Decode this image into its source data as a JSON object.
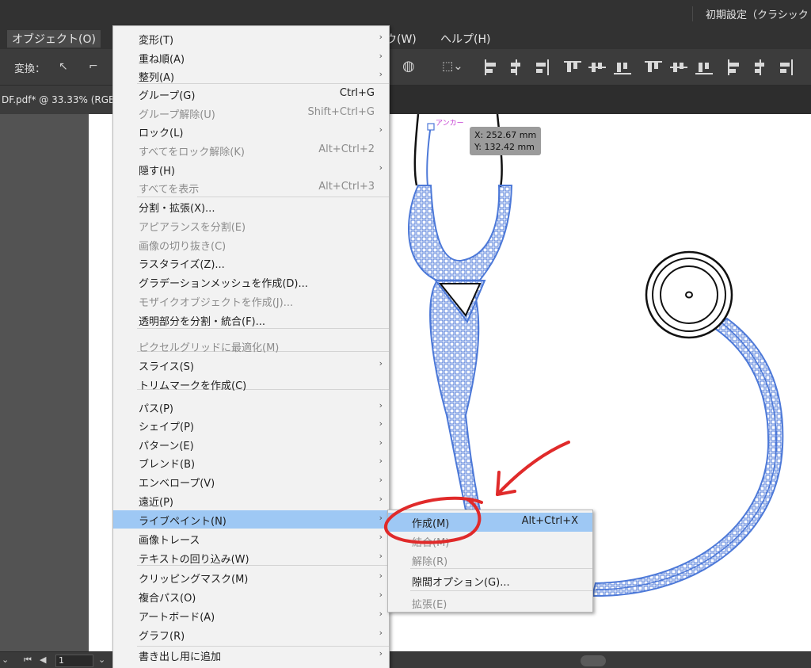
{
  "workspace": {
    "label": "初期設定（クラシック"
  },
  "menubar": {
    "object": "オブジェクト(O)",
    "window": "ウ(W)",
    "help": "ヘルプ(H)"
  },
  "controlbar": {
    "transform_label": "変換："
  },
  "document": {
    "tab_label": "DF.pdf* @ 33.33% (RGB"
  },
  "status": {
    "page": "1"
  },
  "tooltip": {
    "x": "X: 252.67 mm",
    "y": "Y: 132.42 mm"
  },
  "anchor_label": "アンカー",
  "object_menu": {
    "items": [
      {
        "label": "変形(T)",
        "submenu": true
      },
      {
        "label": "重ね順(A)",
        "submenu": true
      },
      {
        "label": "整列(A)",
        "submenu": true
      },
      {
        "label": "グループ(G)",
        "shortcut": "Ctrl+G"
      },
      {
        "label": "グループ解除(U)",
        "shortcut": "Shift+Ctrl+G",
        "disabled": true
      },
      {
        "label": "ロック(L)",
        "submenu": true
      },
      {
        "label": "すべてをロック解除(K)",
        "shortcut": "Alt+Ctrl+2",
        "disabled": true
      },
      {
        "label": "隠す(H)",
        "submenu": true
      },
      {
        "label": "すべてを表示",
        "shortcut": "Alt+Ctrl+3",
        "disabled": true
      },
      {
        "label": "分割・拡張(X)..."
      },
      {
        "label": "アピアランスを分割(E)",
        "disabled": true
      },
      {
        "label": "画像の切り抜き(C)",
        "disabled": true
      },
      {
        "label": "ラスタライズ(Z)..."
      },
      {
        "label": "グラデーションメッシュを作成(D)..."
      },
      {
        "label": "モザイクオブジェクトを作成(J)...",
        "disabled": true
      },
      {
        "label": "透明部分を分割・統合(F)..."
      },
      {
        "label": "ピクセルグリッドに最適化(M)",
        "disabled": true
      },
      {
        "label": "スライス(S)",
        "submenu": true
      },
      {
        "label": "トリムマークを作成(C)"
      },
      {
        "label": "パス(P)",
        "submenu": true
      },
      {
        "label": "シェイプ(P)",
        "submenu": true
      },
      {
        "label": "パターン(E)",
        "submenu": true
      },
      {
        "label": "ブレンド(B)",
        "submenu": true
      },
      {
        "label": "エンベロープ(V)",
        "submenu": true
      },
      {
        "label": "遠近(P)",
        "submenu": true
      },
      {
        "label": "ライブペイント(N)",
        "submenu": true,
        "highlighted": true
      },
      {
        "label": "画像トレース",
        "submenu": true
      },
      {
        "label": "テキストの回り込み(W)",
        "submenu": true
      },
      {
        "label": "クリッピングマスク(M)",
        "submenu": true
      },
      {
        "label": "複合パス(O)",
        "submenu": true
      },
      {
        "label": "アートボード(A)",
        "submenu": true
      },
      {
        "label": "グラフ(R)",
        "submenu": true
      },
      {
        "label": "書き出し用に追加",
        "submenu": true
      }
    ]
  },
  "live_paint_submenu": {
    "items": [
      {
        "label": "作成(M)",
        "shortcut": "Alt+Ctrl+X",
        "highlighted": true
      },
      {
        "label": "結合(M)",
        "disabled": true
      },
      {
        "label": "解除(R)",
        "disabled": true
      },
      {
        "label": "隙間オプション(G)..."
      },
      {
        "label": "拡張(E)",
        "disabled": true
      }
    ]
  },
  "colors": {
    "menu_highlight": "#9ec8f4",
    "selection_blue": "#4d79d8",
    "annotation_red": "#e02a2a"
  }
}
